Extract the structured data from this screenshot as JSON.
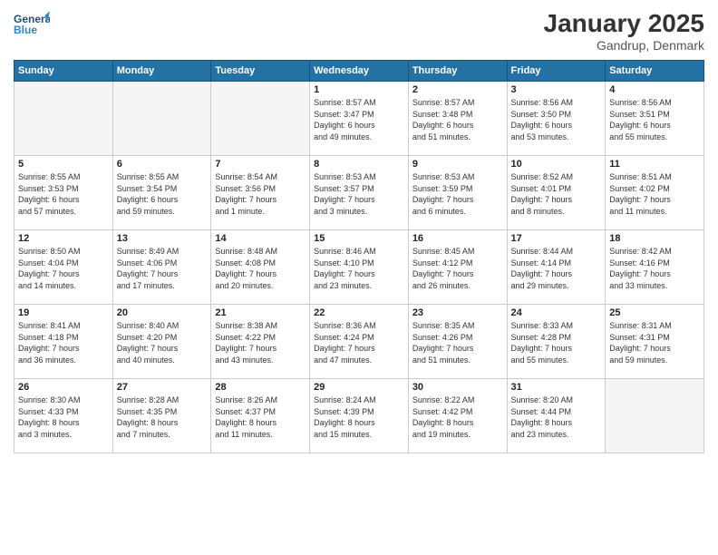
{
  "header": {
    "logo_line1": "General",
    "logo_line2": "Blue",
    "month": "January 2025",
    "location": "Gandrup, Denmark"
  },
  "weekdays": [
    "Sunday",
    "Monday",
    "Tuesday",
    "Wednesday",
    "Thursday",
    "Friday",
    "Saturday"
  ],
  "weeks": [
    [
      {
        "day": "",
        "info": ""
      },
      {
        "day": "",
        "info": ""
      },
      {
        "day": "",
        "info": ""
      },
      {
        "day": "1",
        "info": "Sunrise: 8:57 AM\nSunset: 3:47 PM\nDaylight: 6 hours\nand 49 minutes."
      },
      {
        "day": "2",
        "info": "Sunrise: 8:57 AM\nSunset: 3:48 PM\nDaylight: 6 hours\nand 51 minutes."
      },
      {
        "day": "3",
        "info": "Sunrise: 8:56 AM\nSunset: 3:50 PM\nDaylight: 6 hours\nand 53 minutes."
      },
      {
        "day": "4",
        "info": "Sunrise: 8:56 AM\nSunset: 3:51 PM\nDaylight: 6 hours\nand 55 minutes."
      }
    ],
    [
      {
        "day": "5",
        "info": "Sunrise: 8:55 AM\nSunset: 3:53 PM\nDaylight: 6 hours\nand 57 minutes."
      },
      {
        "day": "6",
        "info": "Sunrise: 8:55 AM\nSunset: 3:54 PM\nDaylight: 6 hours\nand 59 minutes."
      },
      {
        "day": "7",
        "info": "Sunrise: 8:54 AM\nSunset: 3:56 PM\nDaylight: 7 hours\nand 1 minute."
      },
      {
        "day": "8",
        "info": "Sunrise: 8:53 AM\nSunset: 3:57 PM\nDaylight: 7 hours\nand 3 minutes."
      },
      {
        "day": "9",
        "info": "Sunrise: 8:53 AM\nSunset: 3:59 PM\nDaylight: 7 hours\nand 6 minutes."
      },
      {
        "day": "10",
        "info": "Sunrise: 8:52 AM\nSunset: 4:01 PM\nDaylight: 7 hours\nand 8 minutes."
      },
      {
        "day": "11",
        "info": "Sunrise: 8:51 AM\nSunset: 4:02 PM\nDaylight: 7 hours\nand 11 minutes."
      }
    ],
    [
      {
        "day": "12",
        "info": "Sunrise: 8:50 AM\nSunset: 4:04 PM\nDaylight: 7 hours\nand 14 minutes."
      },
      {
        "day": "13",
        "info": "Sunrise: 8:49 AM\nSunset: 4:06 PM\nDaylight: 7 hours\nand 17 minutes."
      },
      {
        "day": "14",
        "info": "Sunrise: 8:48 AM\nSunset: 4:08 PM\nDaylight: 7 hours\nand 20 minutes."
      },
      {
        "day": "15",
        "info": "Sunrise: 8:46 AM\nSunset: 4:10 PM\nDaylight: 7 hours\nand 23 minutes."
      },
      {
        "day": "16",
        "info": "Sunrise: 8:45 AM\nSunset: 4:12 PM\nDaylight: 7 hours\nand 26 minutes."
      },
      {
        "day": "17",
        "info": "Sunrise: 8:44 AM\nSunset: 4:14 PM\nDaylight: 7 hours\nand 29 minutes."
      },
      {
        "day": "18",
        "info": "Sunrise: 8:42 AM\nSunset: 4:16 PM\nDaylight: 7 hours\nand 33 minutes."
      }
    ],
    [
      {
        "day": "19",
        "info": "Sunrise: 8:41 AM\nSunset: 4:18 PM\nDaylight: 7 hours\nand 36 minutes."
      },
      {
        "day": "20",
        "info": "Sunrise: 8:40 AM\nSunset: 4:20 PM\nDaylight: 7 hours\nand 40 minutes."
      },
      {
        "day": "21",
        "info": "Sunrise: 8:38 AM\nSunset: 4:22 PM\nDaylight: 7 hours\nand 43 minutes."
      },
      {
        "day": "22",
        "info": "Sunrise: 8:36 AM\nSunset: 4:24 PM\nDaylight: 7 hours\nand 47 minutes."
      },
      {
        "day": "23",
        "info": "Sunrise: 8:35 AM\nSunset: 4:26 PM\nDaylight: 7 hours\nand 51 minutes."
      },
      {
        "day": "24",
        "info": "Sunrise: 8:33 AM\nSunset: 4:28 PM\nDaylight: 7 hours\nand 55 minutes."
      },
      {
        "day": "25",
        "info": "Sunrise: 8:31 AM\nSunset: 4:31 PM\nDaylight: 7 hours\nand 59 minutes."
      }
    ],
    [
      {
        "day": "26",
        "info": "Sunrise: 8:30 AM\nSunset: 4:33 PM\nDaylight: 8 hours\nand 3 minutes."
      },
      {
        "day": "27",
        "info": "Sunrise: 8:28 AM\nSunset: 4:35 PM\nDaylight: 8 hours\nand 7 minutes."
      },
      {
        "day": "28",
        "info": "Sunrise: 8:26 AM\nSunset: 4:37 PM\nDaylight: 8 hours\nand 11 minutes."
      },
      {
        "day": "29",
        "info": "Sunrise: 8:24 AM\nSunset: 4:39 PM\nDaylight: 8 hours\nand 15 minutes."
      },
      {
        "day": "30",
        "info": "Sunrise: 8:22 AM\nSunset: 4:42 PM\nDaylight: 8 hours\nand 19 minutes."
      },
      {
        "day": "31",
        "info": "Sunrise: 8:20 AM\nSunset: 4:44 PM\nDaylight: 8 hours\nand 23 minutes."
      },
      {
        "day": "",
        "info": ""
      }
    ]
  ]
}
